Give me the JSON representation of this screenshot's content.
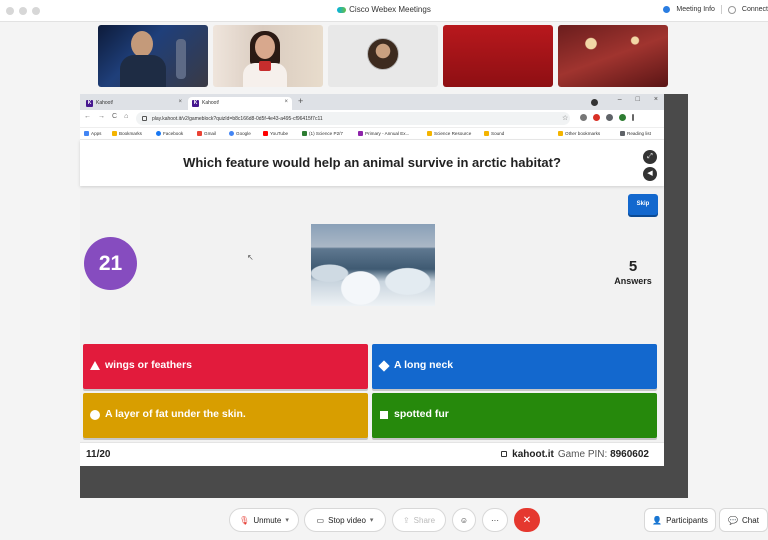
{
  "titlebar": {
    "title": "Cisco Webex Meetings",
    "meeting_info": "Meeting Info",
    "connect": "Connect",
    "meeting_info_icon": "info-dot-icon"
  },
  "video_tiles": [
    {
      "icon": "participant-video"
    },
    {
      "icon": "participant-video"
    },
    {
      "icon": "participant-avatar"
    },
    {
      "icon": "participant-video"
    },
    {
      "icon": "participant-video"
    }
  ],
  "browser": {
    "tabs": [
      {
        "label": "Kahoot!",
        "close": "×"
      },
      {
        "label": "Kahoot!",
        "close": "×"
      }
    ],
    "new_tab": "+",
    "window_controls": [
      "–",
      "□",
      "×"
    ],
    "url": "play.kahoot.it/v2/gameblock?quizId=b8c166d8-0d5f-4e43-a495-cf96415f7c11",
    "nav": [
      "←",
      "→",
      "C",
      "⌂"
    ],
    "bookmarks": [
      {
        "label": "Apps",
        "color": "#4285f4"
      },
      {
        "label": "Bookmarks",
        "color": "#f4b400"
      },
      {
        "label": "Facebook",
        "color": "#1877f2"
      },
      {
        "label": "Gmail",
        "color": "#ea4335"
      },
      {
        "label": "Google",
        "color": "#4285f4"
      },
      {
        "label": "YouTube",
        "color": "#ff0000"
      },
      {
        "label": "(1) Science P2/7",
        "color": "#2e7d32"
      },
      {
        "label": "Primary - Annual Ex...",
        "color": "#8e24aa"
      },
      {
        "label": "Science Resource",
        "color": "#f4b400"
      },
      {
        "label": "Sound",
        "color": "#f4b400"
      },
      {
        "label": "Other bookmarks",
        "color": "#f4b400"
      },
      {
        "label": "Reading list",
        "color": "#5f6368"
      }
    ]
  },
  "kahoot": {
    "question": "Which feature would help an animal survive in arctic habitat?",
    "fullscreen_icon": "fullscreen-icon",
    "sound_icon": "speaker-icon",
    "skip_label": "Skip",
    "timer": "21",
    "answers_count": "5",
    "answers_label": "Answers",
    "answers": [
      {
        "text": "wings or feathers",
        "shape": "triangle",
        "color": "#e21b3c"
      },
      {
        "text": "A long neck",
        "shape": "diamond",
        "color": "#1368ce"
      },
      {
        "text": "A layer of fat under the skin.",
        "shape": "circle",
        "color": "#d89e00"
      },
      {
        "text": "spotted fur",
        "shape": "square",
        "color": "#26890c"
      }
    ],
    "question_number": "11/20",
    "site": "kahoot.it",
    "game_pin_label": "Game PIN:",
    "game_pin": "8960602"
  },
  "controls": {
    "mute": "Unmute",
    "video": "Stop video",
    "share": "Share",
    "emoji_icon": "emoji-icon",
    "more": "···",
    "leave": "✕",
    "participants": "Participants",
    "chat": "Chat"
  }
}
